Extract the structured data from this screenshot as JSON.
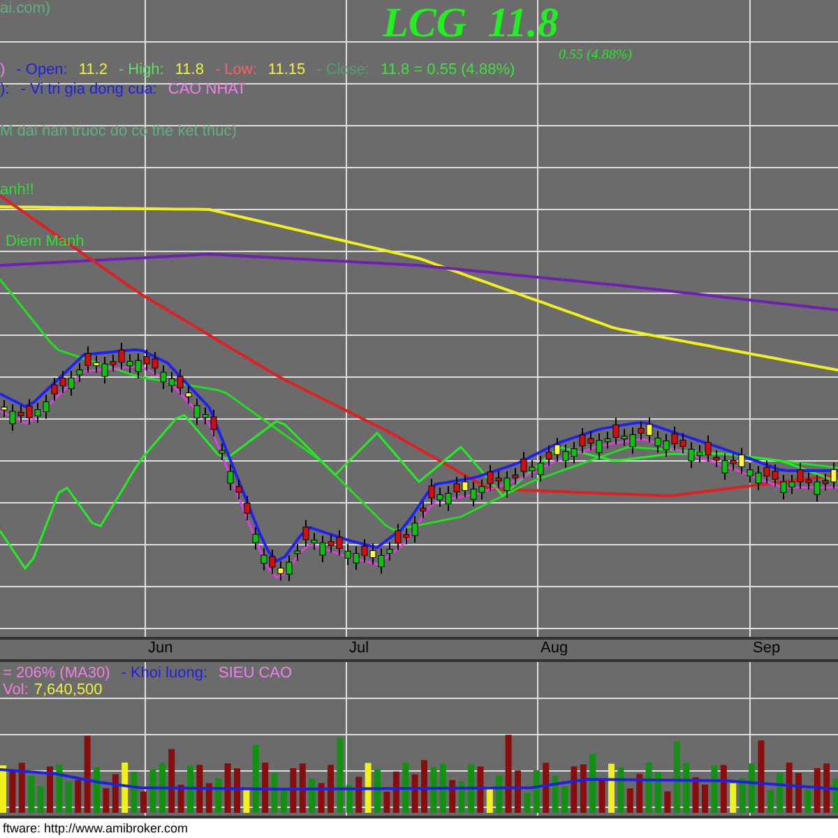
{
  "price_pane": {
    "title_fragment": "ai.com)",
    "ticker": "LCG",
    "price": "11.8",
    "change": "0.55 (4.88%)",
    "quote_line": [
      {
        "text": ")",
        "color": "#f080e0"
      },
      {
        "text": "- Open:",
        "color": "#2020e0"
      },
      {
        "text": "11.2",
        "color": "#f0f040"
      },
      {
        "text": "- High:",
        "color": "#60e060"
      },
      {
        "text": "11.8",
        "color": "#f0f040"
      },
      {
        "text": "- Low:",
        "color": "#ff6060"
      },
      {
        "text": "11.15",
        "color": "#f0f040"
      },
      {
        "text": "- Close:",
        "color": "#50a070"
      },
      {
        "text": "11.8  =  0.55  (4.88%)",
        "color": "#40e040"
      }
    ],
    "position_line": [
      {
        "text": "):",
        "color": "#2020e0"
      },
      {
        "text": "- Vi tri gia dong cua:",
        "color": "#2020e0"
      },
      {
        "text": "CAO NHAT",
        "color": "#f080f0"
      }
    ],
    "note": "M dai han truoc do co the ket thuc)",
    "signal_top": "anh!!",
    "signal_bottom": "Diem Manh"
  },
  "months": [
    "Jun",
    "Jul",
    "Aug",
    "Sep"
  ],
  "volume_pane": {
    "ratio_line": [
      {
        "text": "=  206%  (MA30)",
        "color": "#f080e0"
      },
      {
        "text": "- Khoi luong:",
        "color": "#2020e0"
      },
      {
        "text": "SIEU CAO",
        "color": "#f080f0"
      }
    ],
    "vol_label": "Vol:",
    "vol_value": "7,640,500"
  },
  "footer": "ftware:  http://www.amibroker.com"
}
